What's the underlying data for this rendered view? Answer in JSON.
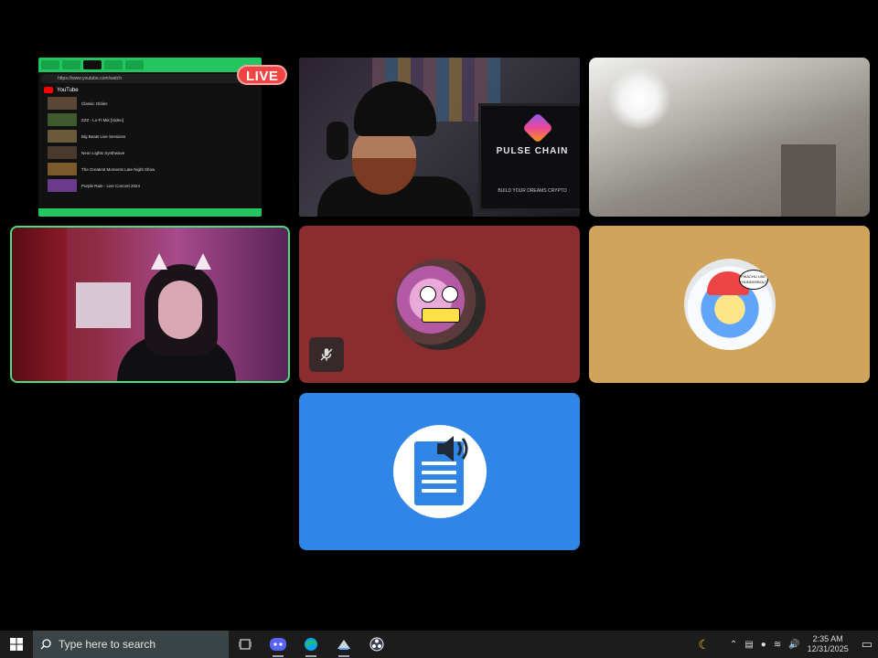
{
  "screen_share": {
    "live_label": "LIVE",
    "url": "https://www.youtube.com/watch",
    "site": "YouTube",
    "rows": [
      {
        "title": "Classic Oldies",
        "color": "#5b4636"
      },
      {
        "title": "ZZZ - Lo-Fi Mix [Video]",
        "color": "#3f5a2e"
      },
      {
        "title": "Big Beats Live Sessions",
        "color": "#6b5b3a"
      },
      {
        "title": "Neon Lights Synthwave",
        "color": "#4a3a2e"
      },
      {
        "title": "The Greatest Moments Late Night Show",
        "color": "#7a5a2a"
      },
      {
        "title": "Purple Rain - Live Concert 2024",
        "color": "#6b3a8a"
      }
    ]
  },
  "monitor": {
    "title": "PULSE CHAIN",
    "subtitle": "BUILD YOUR DREAMS CRYPTO"
  },
  "avatar_2": {
    "bubble_text": "PIKACHU USE THUNDERBOLT!"
  },
  "taskbar": {
    "search_placeholder": "Type here to search",
    "time": "2:35 AM",
    "date": "12/31/2025"
  },
  "colors": {
    "live_red": "#ef4444",
    "active_speaker_border": "#4ade80",
    "avatar_red_bg": "#8b2c2f",
    "avatar_gold_bg": "#d0a45b",
    "audio_tile_bg": "#2f86e6"
  },
  "icons": [
    "windows-start-icon",
    "search-icon",
    "task-view-icon",
    "discord-icon",
    "edge-icon",
    "steam-icon",
    "obs-icon",
    "moon-icon",
    "chevron-up-icon",
    "network-icon",
    "microphone-icon",
    "wifi-icon",
    "volume-icon",
    "notification-icon",
    "mic-muted-icon",
    "document-speaker-icon"
  ]
}
